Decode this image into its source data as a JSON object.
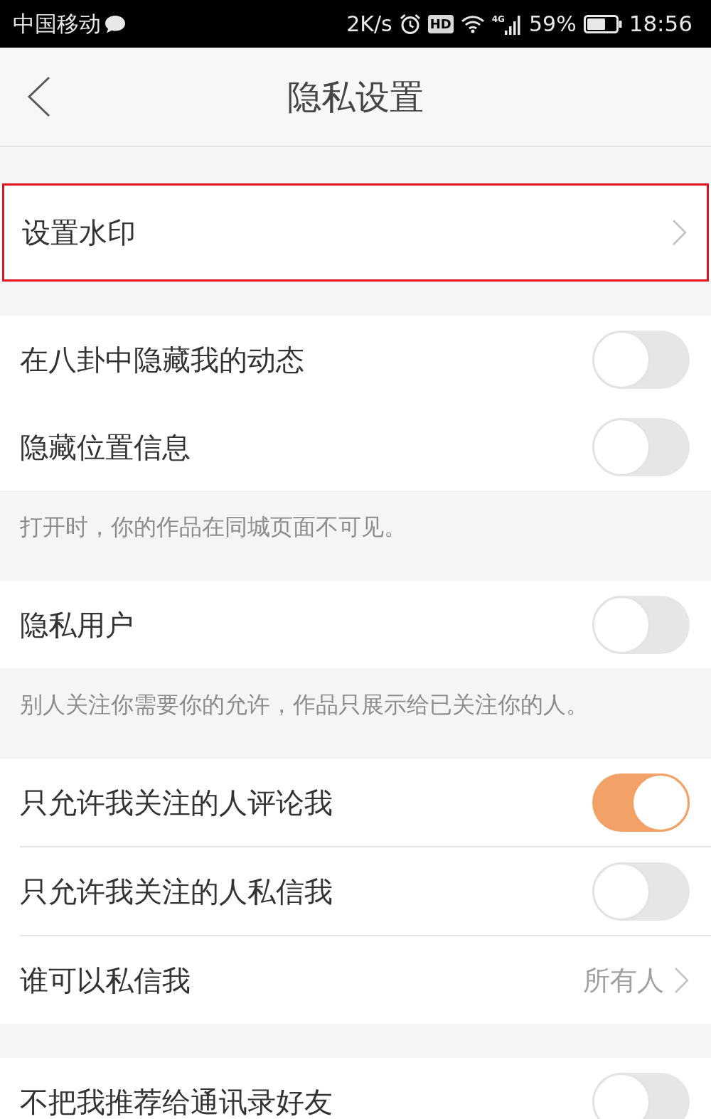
{
  "status_bar": {
    "carrier": "中国移动",
    "speed": "2K/s",
    "hd": "HD",
    "network": "4G",
    "battery": "59%",
    "time": "18:56"
  },
  "header": {
    "title": "隐私设置"
  },
  "sections": [
    {
      "rows": [
        {
          "kind": "link",
          "label": "设置水印",
          "highlighted": true
        }
      ]
    },
    {
      "dividers": false,
      "rows": [
        {
          "kind": "toggle",
          "label": "在八卦中隐藏我的动态",
          "on": false
        },
        {
          "kind": "toggle",
          "label": "隐藏位置信息",
          "on": false
        }
      ],
      "note": "打开时，你的作品在同城页面不可见。"
    },
    {
      "rows": [
        {
          "kind": "toggle",
          "label": "隐私用户",
          "on": false
        }
      ],
      "note": "别人关注你需要你的允许，作品只展示给已关注你的人。"
    },
    {
      "dividers": true,
      "rows": [
        {
          "kind": "toggle",
          "label": "只允许我关注的人评论我",
          "on": true
        },
        {
          "kind": "toggle",
          "label": "只允许我关注的人私信我",
          "on": false
        },
        {
          "kind": "link",
          "label": "谁可以私信我",
          "value": "所有人"
        }
      ]
    },
    {
      "rows": [
        {
          "kind": "toggle",
          "label": "不把我推荐给通讯录好友",
          "on": false
        }
      ]
    }
  ]
}
